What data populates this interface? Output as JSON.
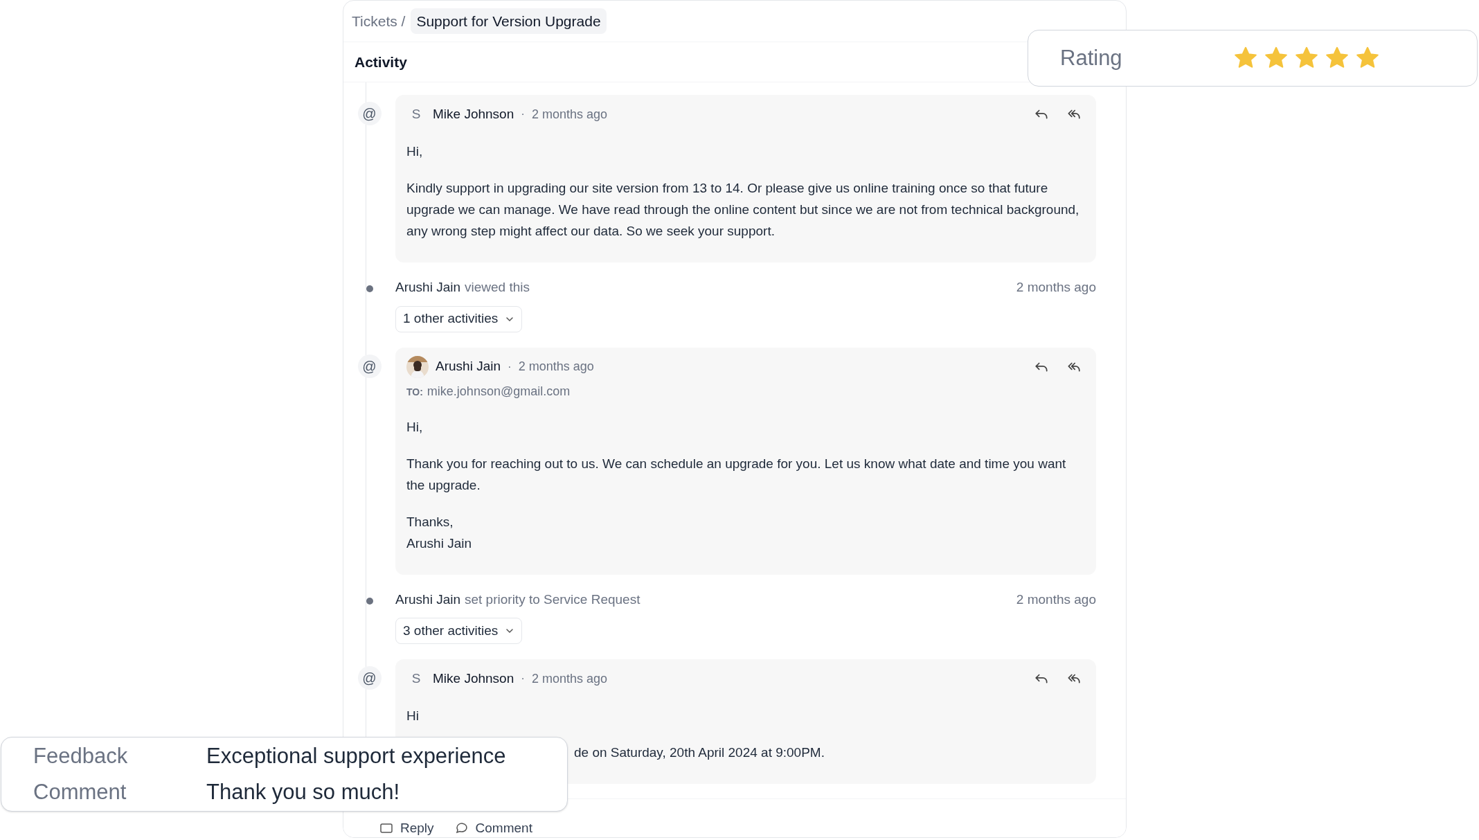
{
  "breadcrumb": {
    "parent": "Tickets /",
    "current": "Support for Version Upgrade"
  },
  "section_title": "Activity",
  "activity": [
    {
      "kind": "email",
      "marker": "@",
      "avatar": {
        "kind": "initial",
        "text": "S"
      },
      "author": "Mike Johnson",
      "separator": "·",
      "time": "2 months ago",
      "body": [
        {
          "text": "Hi,",
          "cut": false
        },
        {
          "text": "Kindly support in upgrading our site version from 13 to 14. Or please give us online training once so that future upgrade we can manage. We have read through the online content but since we are not from technical background, any wrong step might affect our data. So we seek your support.",
          "cut": false
        }
      ]
    },
    {
      "kind": "event",
      "actor": "Arushi Jain",
      "action": "viewed this",
      "time": "2 months ago",
      "more": "1 other activities"
    },
    {
      "kind": "email",
      "marker": "@",
      "author": "Arushi Jain",
      "separator": "·",
      "time": "2 months ago",
      "to_label": "TO:",
      "to": "mike.johnson@gmail.com",
      "body": [
        {
          "text": "Hi,",
          "cut": false
        },
        {
          "text": "Thank you for reaching out to us. We can schedule an upgrade for you. Let us know what date and time you want the upgrade.",
          "cut": false
        },
        {
          "text": "Thanks,\nArushi Jain",
          "cut": false
        }
      ]
    },
    {
      "kind": "event",
      "actor": "Arushi Jain",
      "action": "set priority to Service Request",
      "time": "2 months ago",
      "more": "3 other activities"
    },
    {
      "kind": "email",
      "marker": "@",
      "avatar": {
        "kind": "initial",
        "text": "S"
      },
      "author": "Mike Johnson",
      "separator": "·",
      "time": "2 months ago",
      "body": [
        {
          "text": "Hi",
          "cut": false
        },
        {
          "text": "de on Saturday, 20th April 2024 at 9:00PM.",
          "cut": true
        }
      ]
    }
  ],
  "composer_actions": [
    {
      "kind": "reply",
      "label": "Reply"
    },
    {
      "kind": "comment",
      "label": "Comment"
    }
  ],
  "rating": {
    "label": "Rating",
    "stars": 5
  },
  "feedback": [
    {
      "label": "Feedback",
      "value": "Exceptional support experience"
    },
    {
      "label": "Comment",
      "value": "Thank you so much!"
    }
  ]
}
